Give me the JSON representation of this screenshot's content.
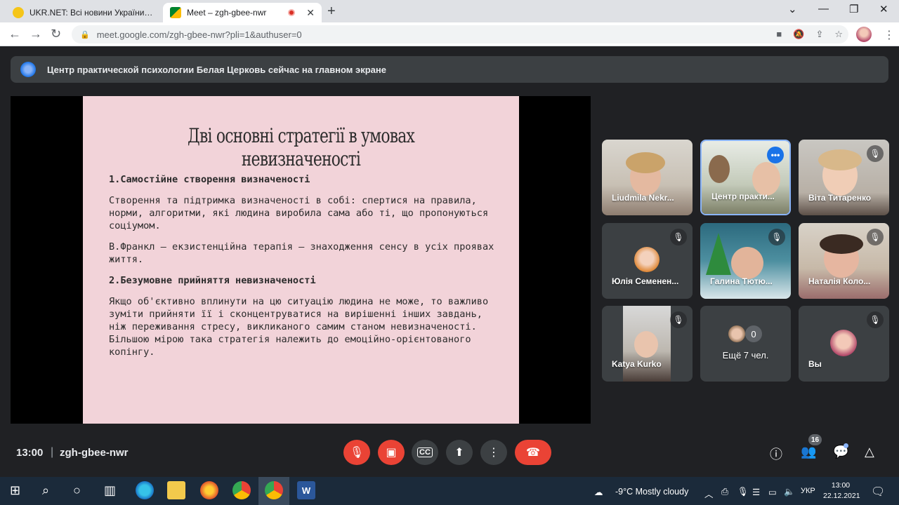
{
  "browser": {
    "tabs": [
      {
        "title": "UKR.NET: Всі новини України, ос"
      },
      {
        "title": "Meet – zgh-gbee-nwr"
      }
    ],
    "url": "meet.google.com/zgh-gbee-nwr?pli=1&authuser=0"
  },
  "meet": {
    "presenting_banner": "Центр практической психологии Белая Церковь сейчас на главном экране",
    "slide": {
      "title": "Дві основні стратегії в умовах невизначеності",
      "heading1": "1.Самостійне створення визначеності",
      "para1": "Створення та підтримка визначеності в собі: спертися на правила, норми, алгоритми, які людина виробила сама або ті, що пропонуються соціумом.",
      "para2": "В.Франкл – екзистенційна терапія – знаходження сенсу в усіх проявах життя.",
      "heading2": "2.Безумовне прийняття невизначеності",
      "para3": "Якщо об'єктивно вплинути на цю ситуацію людина не може, то важливо зуміти прийняти її і сконцентруватися на вирішенні інших завдань, ніж переживання стресу, викликаного самим станом невизначеності. Більшою мірою така стратегія належить до емоційно-орієнтованого копінгу."
    },
    "participants": [
      {
        "name": "Liudmila Nekr..."
      },
      {
        "name": "Центр практи..."
      },
      {
        "name": "Віта Титаренко"
      },
      {
        "name": "Юлія Семенен..."
      },
      {
        "name": "Галина Тютю..."
      },
      {
        "name": "Наталія Коло..."
      },
      {
        "name": "Katya Kurko"
      },
      {
        "name": "Ещё 7 чел."
      },
      {
        "name": "Вы"
      }
    ],
    "more_count": "0",
    "clock": "13:00",
    "meeting_code": "zgh-gbee-nwr",
    "people_count": "16"
  },
  "taskbar": {
    "weather": "-9°C  Mostly cloudy",
    "lang": "УКР",
    "time": "13:00",
    "date": "22.12.2021"
  },
  "colors": {
    "meet_bg": "#202124",
    "tile_bg": "#3c4043",
    "red": "#ea4335",
    "slide_bg": "#f2d3d9",
    "active_border": "#8ab4f8"
  }
}
